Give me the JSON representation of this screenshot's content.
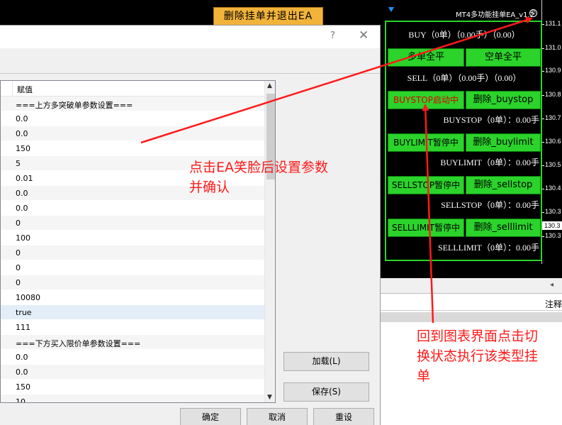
{
  "chart": {
    "top_button_label": "删除挂单并退出EA",
    "ea_title": "MT4多功能挂单EA_v1.2",
    "smiley_icon": "smiley-icon",
    "price_ticks": [
      "131.1",
      "131.0",
      "130.9",
      "130.8",
      "130.7",
      "130.6",
      "130.5",
      "130.4",
      "130.3",
      "130.3"
    ],
    "current_price": "130.3",
    "panel": {
      "buy_status": "BUY（0单）（0.00手）（0.00）",
      "close_long_label": "多单全平",
      "close_short_label": "空单全平",
      "sell_status": "SELL（0单）（0.00手）（0.00）",
      "buystop_toggle": "BUYSTOP启动中",
      "delete_buystop": "删除_buystop",
      "buystop_status": "BUYSTOP（0单）：0.00手",
      "buylimit_toggle": "BUYLIMIT暂停中",
      "delete_buylimit": "删除_buylimit",
      "buylimit_status": "BUYLIMIT（0单）：0.00手",
      "sellstop_toggle": "SELLSTOP暂停中",
      "delete_sellstop": "删除_sellstop",
      "sellstop_status": "SELLSTOP（0单）：0.00手",
      "selllimit_toggle": "SELLLIMIT暂停中",
      "delete_selllimit": "删除_selllimit",
      "selllimit_status": "SELLLIMIT（0单）：0.00手"
    },
    "colors": {
      "panel_green": "#2bd32b",
      "active_text": "#e00000",
      "top_button": "#f2b33a"
    }
  },
  "terminal": {
    "scroll_left_icon": "scroll-left-icon",
    "header_label": "注释"
  },
  "dialog": {
    "help_label": "?",
    "close_label": "✕",
    "value_column_header": "赋值",
    "rows": [
      "===上方多突破单参数设置===",
      "0.0",
      "0.0",
      "150",
      "5",
      "0.01",
      "0.0",
      "0.0",
      "0",
      "100",
      "0",
      "0",
      "0",
      "10080",
      "true",
      "111",
      "===下方买入限价单参数设置===",
      "0.0",
      "0.0",
      "150",
      "10"
    ],
    "load_button": "加载(L)",
    "save_button": "保存(S)",
    "ok_button": "确定",
    "cancel_button": "取消",
    "reset_button": "重设"
  },
  "annotations": {
    "note_settings": [
      "点击EA笑脸后设置参数",
      "并确认"
    ],
    "note_switch": [
      "回到图表界面点击切",
      "换状态执行该类型挂",
      "单"
    ],
    "arrow_color": "#ff1a1a"
  }
}
